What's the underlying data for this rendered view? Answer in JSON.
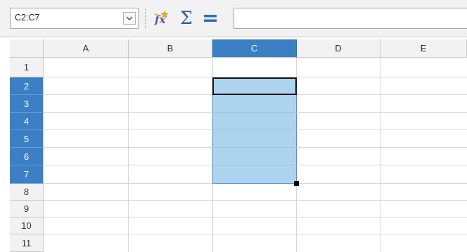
{
  "formula_bar": {
    "name_box_value": "C2:C7",
    "function_wizard_icon": "function-wizard-icon",
    "sum_icon": "sigma-sum-icon",
    "sum_glyph": "Σ",
    "formula_icon": "equals-formula-icon",
    "input_value": ""
  },
  "columns": [
    "A",
    "B",
    "C",
    "D",
    "E"
  ],
  "rows": [
    "1",
    "2",
    "3",
    "4",
    "5",
    "6",
    "7",
    "8",
    "9",
    "10",
    "11"
  ],
  "selection": {
    "range": "C2:C7",
    "active_cell": "C2",
    "selected_column": "C",
    "selected_rows": [
      "2",
      "3",
      "4",
      "5",
      "6",
      "7"
    ]
  },
  "colors": {
    "header_selected": "#3b7fc4",
    "range_fill": "#aed3ee",
    "header_bg": "#f2f2f2"
  }
}
